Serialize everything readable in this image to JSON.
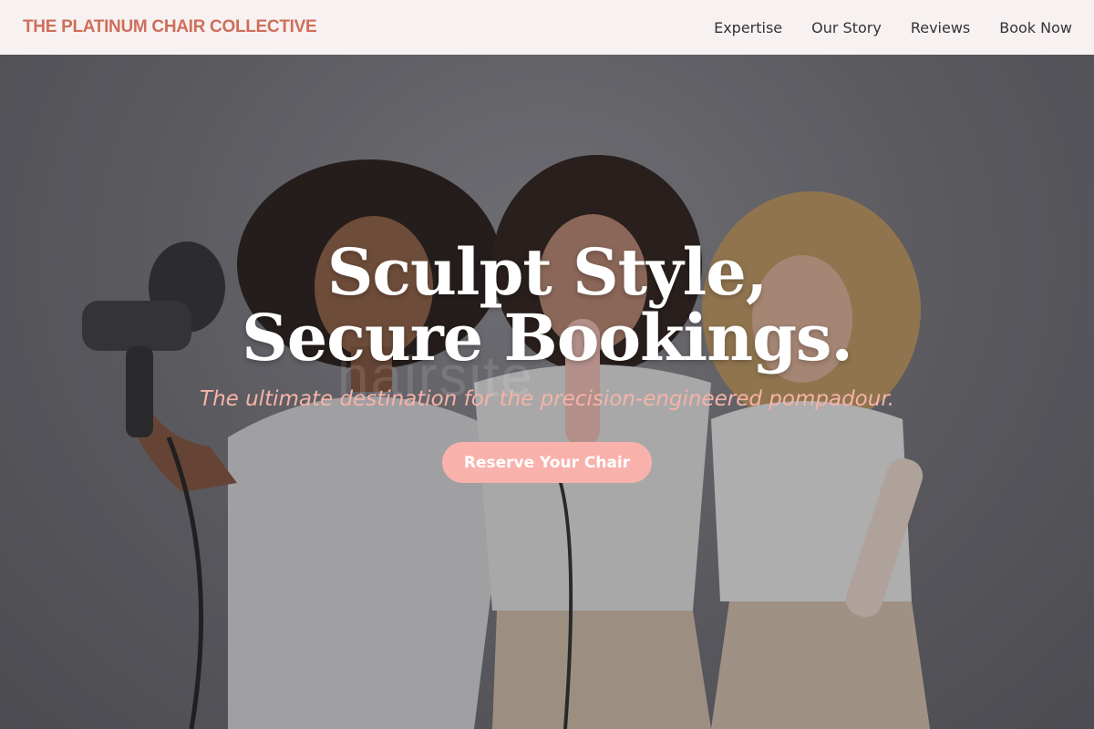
{
  "header": {
    "brand": "THE PLATINUM CHAIR COLLECTIVE",
    "nav": [
      "Expertise",
      "Our Story",
      "Reviews",
      "Book Now"
    ]
  },
  "hero": {
    "headline": "Sculpt Style, Secure Bookings.",
    "tagline": "The ultimate destination for the precision-engineered pompadour.",
    "cta_label": "Reserve Your Chair",
    "watermark": "hairsite"
  },
  "colors": {
    "brand": "#cf6e5a",
    "navbar_bg": "#f7f1f1",
    "tagline": "#f6b3a8",
    "cta_bg": "#f9b2ab"
  }
}
